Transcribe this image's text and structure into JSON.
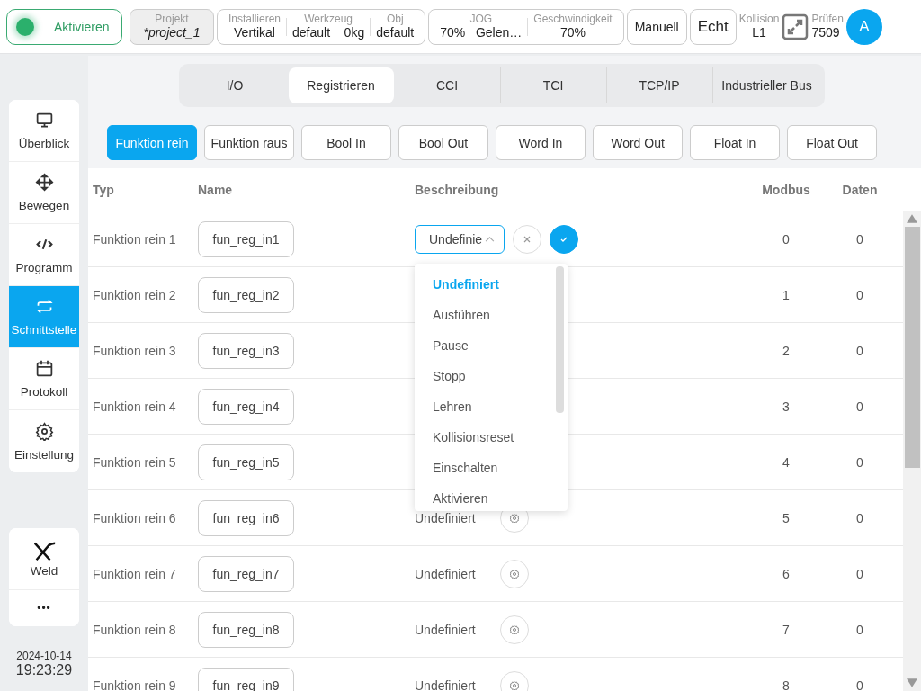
{
  "topbar": {
    "activate": {
      "label": "Aktivieren",
      "on": true
    },
    "project": {
      "label": "Projekt",
      "value": "*project_1"
    },
    "groups": [
      [
        {
          "label": "Installieren",
          "value": "Vertikal"
        },
        {
          "label": "Werkzeug",
          "value": "default    0kg"
        },
        {
          "label": "Obj",
          "value": "default"
        }
      ],
      [
        {
          "label": "JOG",
          "value": "70%   Gelen…"
        },
        {
          "label": "Geschwindigkeit",
          "value": "70%"
        }
      ]
    ],
    "mode": "Manuell",
    "sim": "Echt",
    "collision": {
      "label": "Kollision",
      "value": "L1"
    },
    "check": {
      "label": "Prüfen",
      "value": "7509"
    },
    "avatar": "A"
  },
  "sidebar": {
    "items": [
      {
        "label": "Überblick",
        "selected": false
      },
      {
        "label": "Bewegen",
        "selected": false
      },
      {
        "label": "Programm",
        "selected": false
      },
      {
        "label": "Schnittstelle",
        "selected": true
      },
      {
        "label": "Protokoll",
        "selected": false
      },
      {
        "label": "Einstellung",
        "selected": false
      }
    ],
    "extra": [
      {
        "label": "Weld",
        "kind": "tool"
      },
      {
        "label": "•••",
        "kind": "more"
      }
    ],
    "date": "2024-10-14",
    "time": "19:23:29"
  },
  "tabs": [
    {
      "label": "I/O",
      "selected": false
    },
    {
      "label": "Registrieren",
      "selected": true
    },
    {
      "label": "CCI",
      "selected": false
    },
    {
      "label": "TCI",
      "selected": false
    },
    {
      "label": "TCP/IP",
      "selected": false
    },
    {
      "label": "Industrieller Bus",
      "selected": false
    }
  ],
  "subtabs": [
    {
      "label": "Funktion rein",
      "selected": true
    },
    {
      "label": "Funktion raus",
      "selected": false
    },
    {
      "label": "Bool In",
      "selected": false
    },
    {
      "label": "Bool Out",
      "selected": false
    },
    {
      "label": "Word In",
      "selected": false
    },
    {
      "label": "Word Out",
      "selected": false
    },
    {
      "label": "Float In",
      "selected": false
    },
    {
      "label": "Float Out",
      "selected": false
    }
  ],
  "table": {
    "columns": [
      "Typ",
      "Name",
      "Beschreibung",
      "Modbus",
      "Daten"
    ],
    "rows": [
      {
        "type": "Funktion rein 1",
        "name": "fun_reg_in1",
        "editing": true,
        "select_value": "Undefinie",
        "modbus": "0",
        "data": "0"
      },
      {
        "type": "Funktion rein 2",
        "name": "fun_reg_in2",
        "editing": false,
        "modbus": "1",
        "data": "0"
      },
      {
        "type": "Funktion rein 3",
        "name": "fun_reg_in3",
        "editing": false,
        "modbus": "2",
        "data": "0"
      },
      {
        "type": "Funktion rein 4",
        "name": "fun_reg_in4",
        "editing": false,
        "modbus": "3",
        "data": "0"
      },
      {
        "type": "Funktion rein 5",
        "name": "fun_reg_in5",
        "editing": false,
        "modbus": "4",
        "data": "0"
      },
      {
        "type": "Funktion rein 6",
        "name": "fun_reg_in6",
        "editing": false,
        "description": "Undefiniert",
        "modbus": "5",
        "data": "0"
      },
      {
        "type": "Funktion rein 7",
        "name": "fun_reg_in7",
        "editing": false,
        "description": "Undefiniert",
        "modbus": "6",
        "data": "0"
      },
      {
        "type": "Funktion rein 8",
        "name": "fun_reg_in8",
        "editing": false,
        "description": "Undefiniert",
        "modbus": "7",
        "data": "0"
      },
      {
        "type": "Funktion rein 9",
        "name": "fun_reg_in9",
        "editing": false,
        "description": "Undefiniert",
        "modbus": "8",
        "data": "0"
      }
    ]
  },
  "dropdown": {
    "options": [
      {
        "label": "Undefiniert",
        "selected": true
      },
      {
        "label": "Ausführen",
        "selected": false
      },
      {
        "label": "Pause",
        "selected": false
      },
      {
        "label": "Stopp",
        "selected": false
      },
      {
        "label": "Lehren",
        "selected": false
      },
      {
        "label": "Kollisionsreset",
        "selected": false
      },
      {
        "label": "Einschalten",
        "selected": false
      },
      {
        "label": "Aktivieren",
        "selected": false
      }
    ]
  }
}
